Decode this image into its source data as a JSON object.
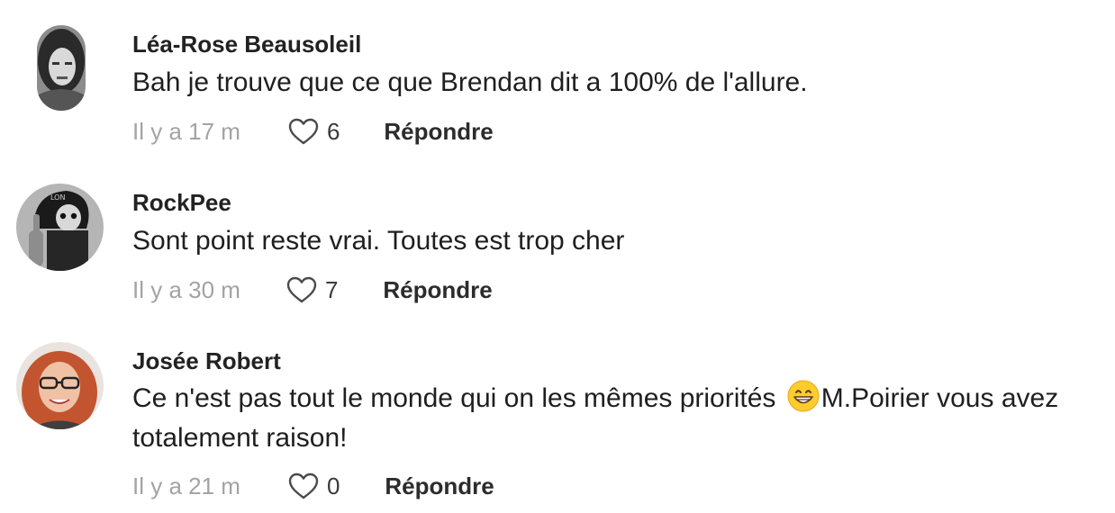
{
  "comments": [
    {
      "author": "Léa-Rose Beausoleil",
      "text": "Bah je trouve que ce que Brendan dit a 100% de l'allure.",
      "time": "Il y a 17 m",
      "likes": "6",
      "reply_label": "Répondre"
    },
    {
      "author": "RockPee",
      "text": "Sont point reste vrai. Toutes est trop cher",
      "time": "Il y a 30 m",
      "likes": "7",
      "reply_label": "Répondre"
    },
    {
      "author": "Josée Robert",
      "text_before_emoji": "Ce n'est pas tout le monde qui on les mêmes priorités",
      "emoji": "grinning-face-emoji",
      "text_after_emoji": "M.Poirier vous avez totalement raison!",
      "time": "Il y a 21 m",
      "likes": "0",
      "reply_label": "Répondre"
    }
  ],
  "icons": {
    "like": "heart-outline-icon"
  },
  "colors": {
    "author": "#222222",
    "text": "#1f1f1f",
    "timestamp": "#a3a3a3",
    "reply": "#2c2c2c"
  }
}
